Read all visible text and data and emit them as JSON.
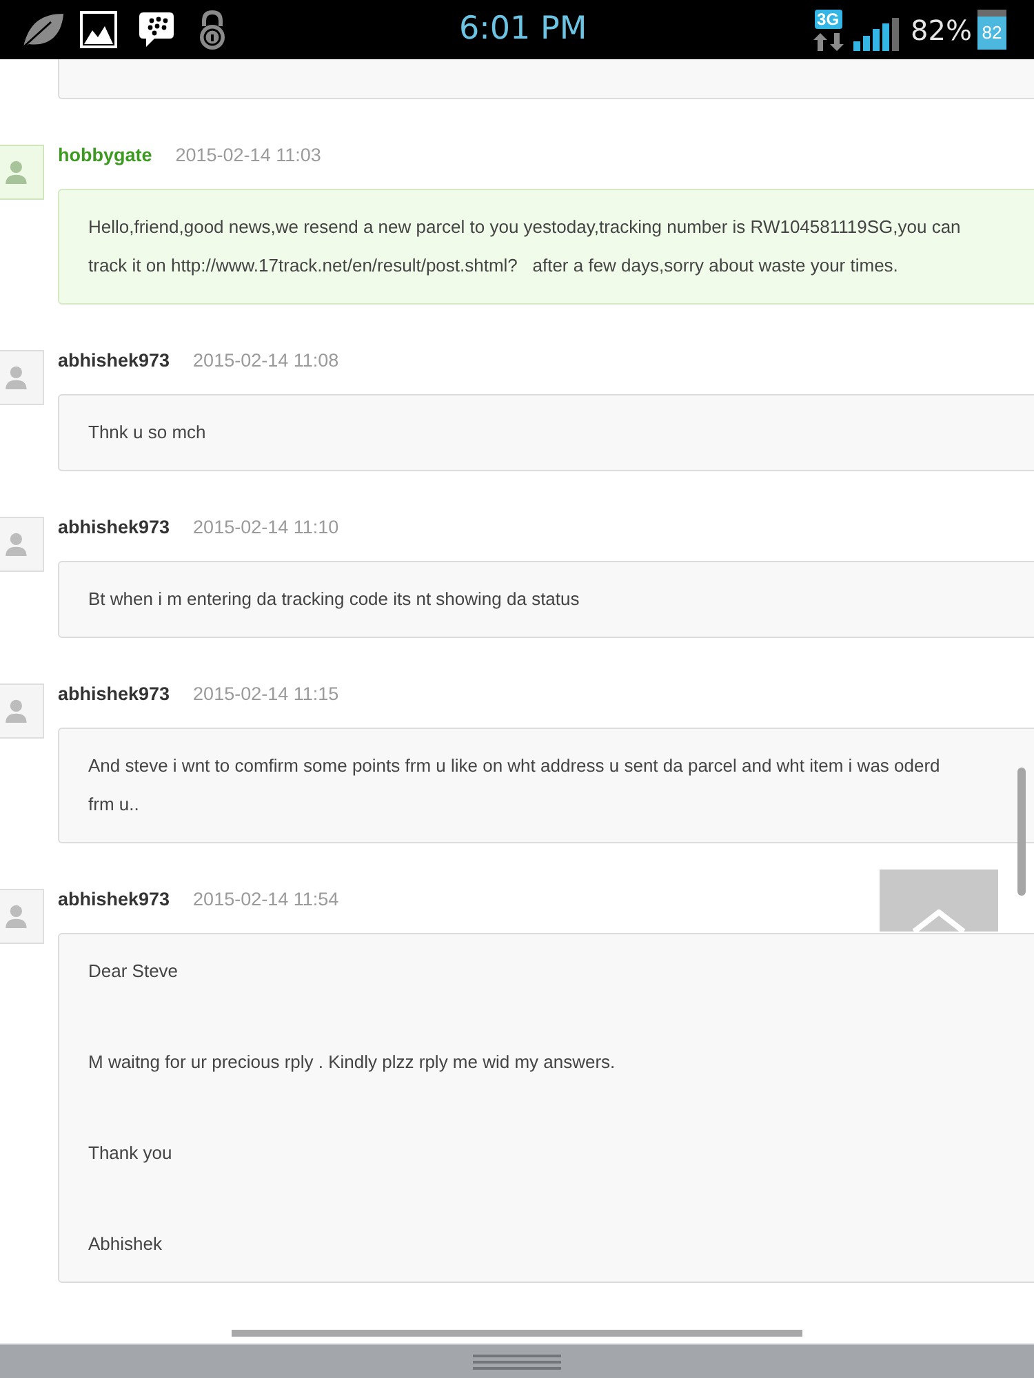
{
  "status_bar": {
    "time": "6:01 PM",
    "network": "3G",
    "battery_percent": "82%",
    "battery_label": "82"
  },
  "messages": [
    {
      "author": "hobbygate",
      "kind": "seller",
      "time": "2015-02-14 11:03",
      "paragraphs": [
        "Hello,friend,good news,we resend a new parcel to you yestoday,tracking number is RW104581119SG,you can track it on http://www.17track.net/en/result/post.shtml?   after a few days,sorry about waste your times."
      ]
    },
    {
      "author": "abhishek973",
      "kind": "buyer",
      "time": "2015-02-14 11:08",
      "paragraphs": [
        "Thnk u so mch"
      ]
    },
    {
      "author": "abhishek973",
      "kind": "buyer",
      "time": "2015-02-14 11:10",
      "paragraphs": [
        "Bt when i m entering da tracking code its nt showing da status"
      ]
    },
    {
      "author": "abhishek973",
      "kind": "buyer",
      "time": "2015-02-14 11:15",
      "paragraphs": [
        "And steve i wnt to comfirm some points frm u like on wht address u sent da parcel and wht item i was oderd frm u.."
      ]
    },
    {
      "author": "abhishek973",
      "kind": "buyer",
      "time": "2015-02-14 11:54",
      "paragraphs": [
        "Dear Steve",
        "M waitng for ur precious rply . Kindly plzz rply me wid my answers.",
        "Thank you",
        "Abhishek"
      ]
    }
  ]
}
